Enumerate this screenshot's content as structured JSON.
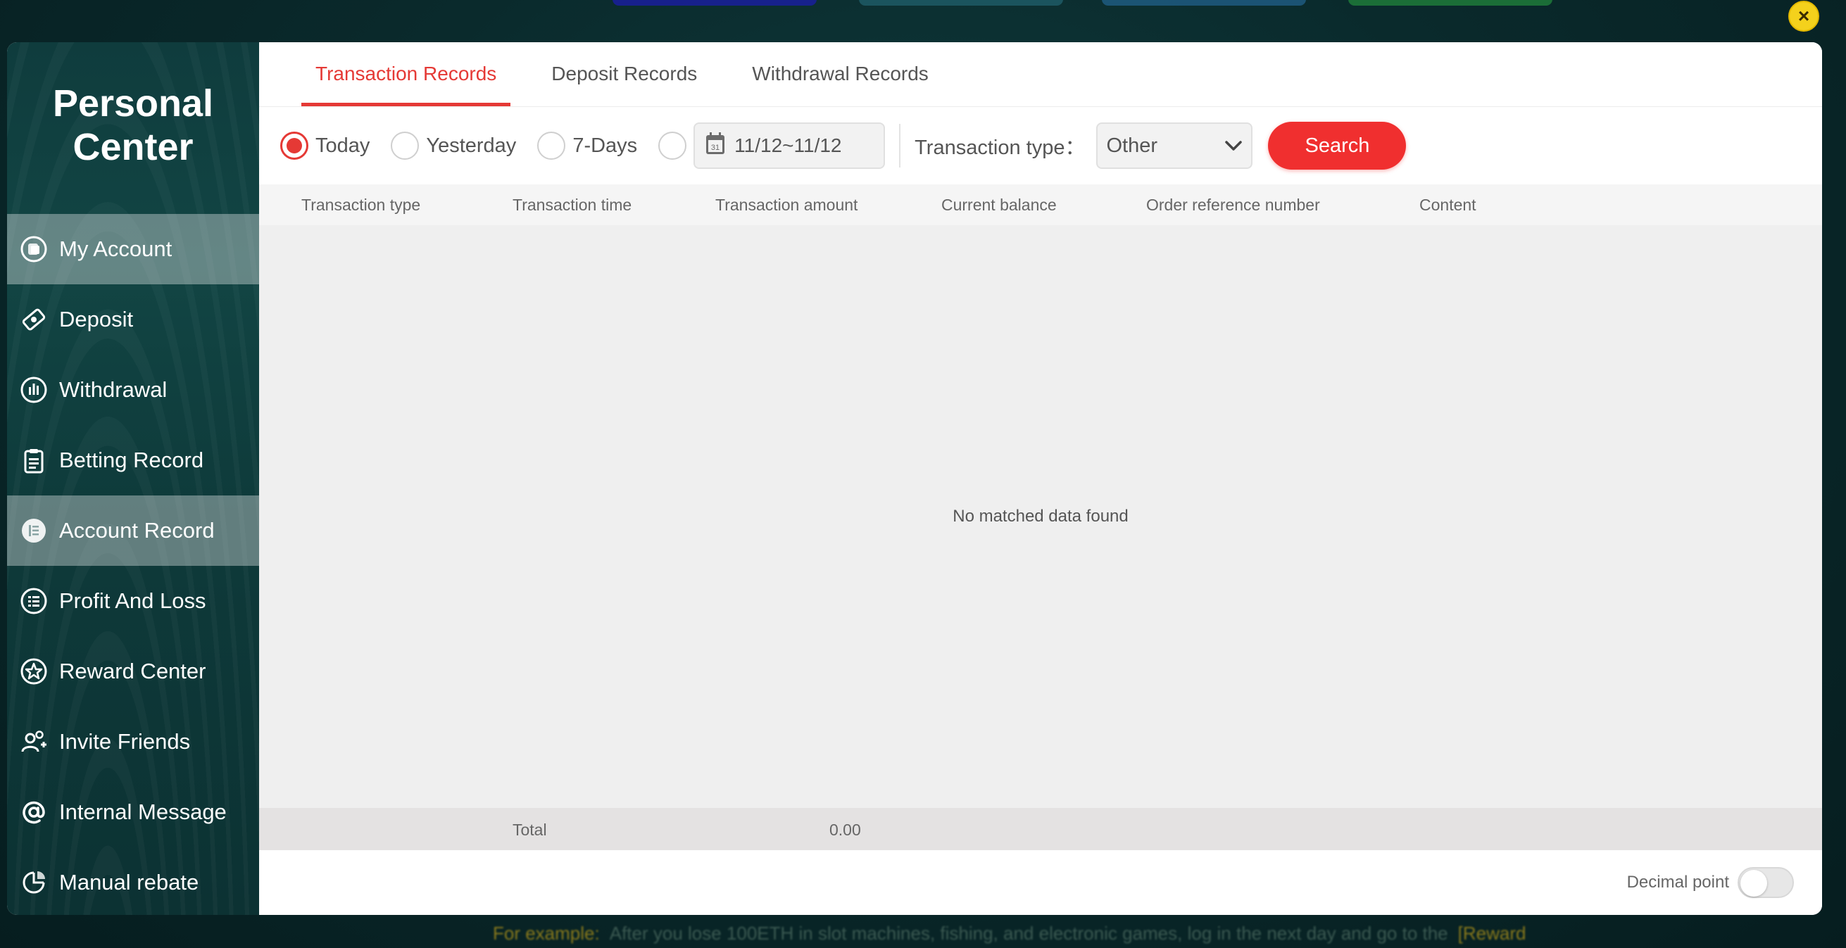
{
  "background": {
    "bottom_banner": {
      "highlight": "For example:",
      "text": "After you lose 100ETH in slot machines, fishing, and electronic games, log in the next day and go to the",
      "end": "[Reward"
    }
  },
  "close_icon": "×",
  "sidebar": {
    "brand_line1": "Personal",
    "brand_line2": "Center",
    "items": [
      {
        "label": "My Account",
        "icon": "account-icon",
        "active": true
      },
      {
        "label": "Deposit",
        "icon": "deposit-icon",
        "active": false
      },
      {
        "label": "Withdrawal",
        "icon": "withdrawal-icon",
        "active": false
      },
      {
        "label": "Betting Record",
        "icon": "clipboard-icon",
        "active": false
      },
      {
        "label": "Account Record",
        "icon": "record-icon",
        "active": true
      },
      {
        "label": "Profit And Loss",
        "icon": "list-icon",
        "active": false
      },
      {
        "label": "Reward Center",
        "icon": "star-icon",
        "active": false
      },
      {
        "label": "Invite Friends",
        "icon": "invite-icon",
        "active": false
      },
      {
        "label": "Internal Message",
        "icon": "at-icon",
        "active": false
      },
      {
        "label": "Manual rebate",
        "icon": "rebate-icon",
        "active": false
      }
    ]
  },
  "tabs": [
    {
      "label": "Transaction Records",
      "active": true
    },
    {
      "label": "Deposit Records",
      "active": false
    },
    {
      "label": "Withdrawal Records",
      "active": false
    }
  ],
  "filters": {
    "today": "Today",
    "yesterday": "Yesterday",
    "seven_days": "7-Days",
    "date_range": "11/12~11/12",
    "type_label": "Transaction type：",
    "type_value": "Other",
    "search": "Search"
  },
  "table": {
    "headers": [
      "Transaction type",
      "Transaction time",
      "Transaction amount",
      "Current balance",
      "Order reference number",
      "Content"
    ],
    "empty_text": "No matched data found",
    "total_label": "Total",
    "total_value": "0.00"
  },
  "footer": {
    "decimal_label": "Decimal point",
    "decimal_on": false
  },
  "colors": {
    "accent": "#e53935",
    "sidebar_bg": "#0f3c3d",
    "search_bg": "#f02f2f"
  }
}
